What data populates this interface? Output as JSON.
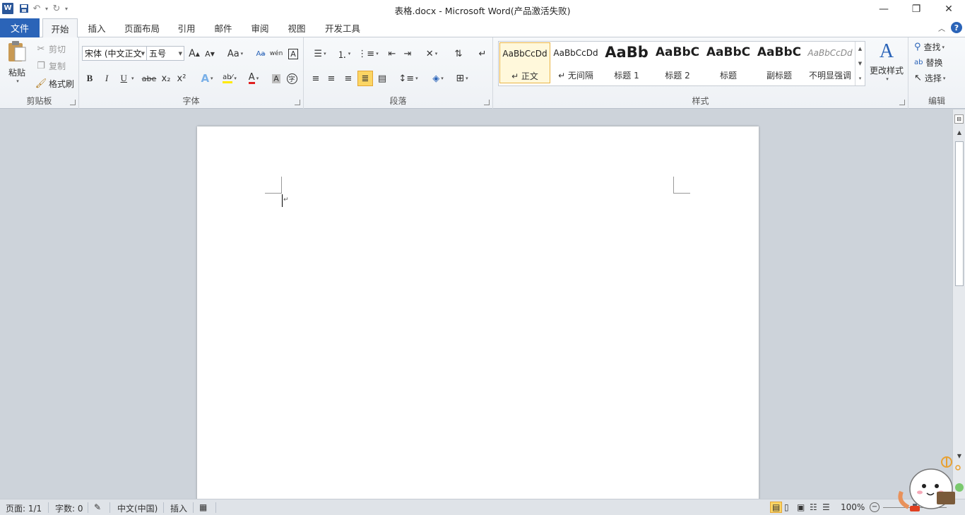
{
  "window": {
    "title": "表格.docx - Microsoft Word(产品激活失败)"
  },
  "tabs": {
    "file": "文件",
    "items": [
      "开始",
      "插入",
      "页面布局",
      "引用",
      "邮件",
      "审阅",
      "视图",
      "开发工具"
    ],
    "active": "开始"
  },
  "clipboard": {
    "paste": "粘贴",
    "cut": "剪切",
    "copy": "复制",
    "format_painter": "格式刷",
    "label": "剪贴板"
  },
  "font": {
    "name": "宋体 (中文正文",
    "size": "五号",
    "label": "字体",
    "case_label": "Aa",
    "bold": "B",
    "italic": "I",
    "underline": "U",
    "strike": "abe",
    "subscript": "x₂",
    "superscript": "x²",
    "grow": "A",
    "shrink": "A"
  },
  "paragraph": {
    "label": "段落"
  },
  "styles": {
    "label": "样式",
    "items": [
      {
        "sample": "AaBbCcDd",
        "name": "↵ 正文"
      },
      {
        "sample": "AaBbCcDd",
        "name": "↵ 无间隔"
      },
      {
        "sample": "AaBb",
        "name": "标题 1"
      },
      {
        "sample": "AaBbC",
        "name": "标题 2"
      },
      {
        "sample": "AaBbC",
        "name": "标题"
      },
      {
        "sample": "AaBbC",
        "name": "副标题"
      },
      {
        "sample": "AaBbCcDd",
        "name": "不明显强调"
      }
    ],
    "change_styles": "更改样式"
  },
  "editing": {
    "label": "编辑",
    "find": "查找",
    "replace": "替换",
    "select": "选择"
  },
  "statusbar": {
    "page": "页面: 1/1",
    "words": "字数: 0",
    "language": "中文(中国)",
    "mode": "插入",
    "zoom": "100%"
  },
  "colors": {
    "file_tab": "#2b64b8",
    "selected_style_border": "#e9b343",
    "align_selected": "#fbd564",
    "font_color": "#e02020",
    "highlight": "#ffea00"
  }
}
